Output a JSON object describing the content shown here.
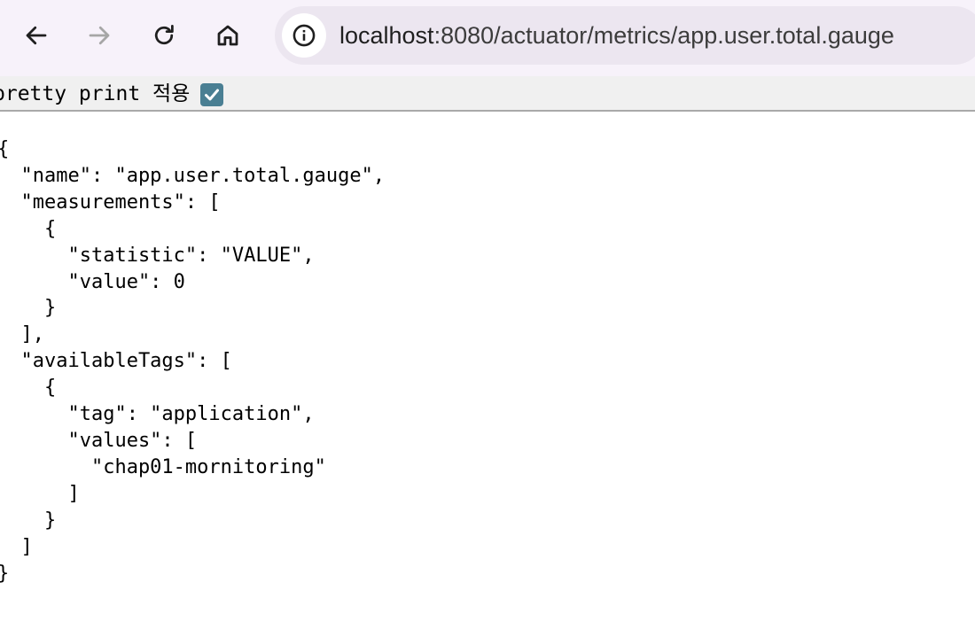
{
  "browser": {
    "back_icon": "arrow-left-icon",
    "forward_icon": "arrow-right-icon",
    "reload_icon": "reload-icon",
    "home_icon": "home-icon",
    "site_info_icon": "info-circle-icon",
    "url_host": "localhost",
    "url_path": ":8080/actuator/metrics/app.user.total.gauge"
  },
  "pretty_print": {
    "label": "pretty print 적용",
    "checked": true,
    "check_color": "#4a7f93"
  },
  "json_lines": [
    "{",
    "  \"name\": \"app.user.total.gauge\",",
    "  \"measurements\": [",
    "    {",
    "      \"statistic\": \"VALUE\",",
    "      \"value\": 0",
    "    }",
    "  ],",
    "  \"availableTags\": [",
    "    {",
    "      \"tag\": \"application\",",
    "      \"values\": [",
    "        \"chap01-mornitoring\"",
    "      ]",
    "    }",
    "  ]",
    "}"
  ]
}
